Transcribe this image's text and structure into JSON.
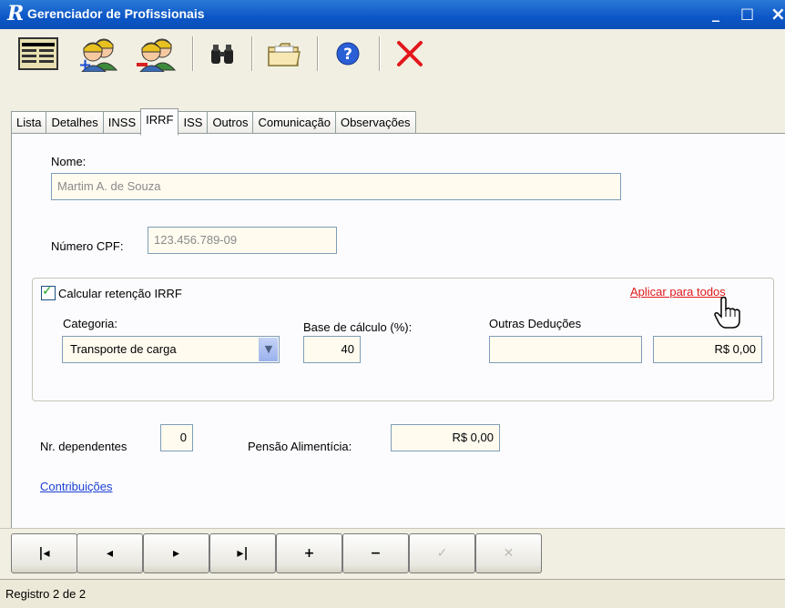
{
  "window": {
    "logo": "R",
    "title": "Gerenciador de Profissionais",
    "minimize": "_",
    "maximize": "□",
    "close": "×"
  },
  "tabs": [
    {
      "label": "Lista"
    },
    {
      "label": "Detalhes"
    },
    {
      "label": "INSS"
    },
    {
      "label": "IRRF"
    },
    {
      "label": "ISS"
    },
    {
      "label": "Outros"
    },
    {
      "label": "Comunicação"
    },
    {
      "label": "Observações"
    }
  ],
  "active_tab": "IRRF",
  "form": {
    "nome_label": "Nome:",
    "nome_value": "Martim A. de Souza",
    "cpf_label": "Número CPF:",
    "cpf_value": "123.456.789-09",
    "irrf_checkbox_label": "Calcular retenção IRRF",
    "irrf_checked": true,
    "aplicar_link": "Aplicar para todos",
    "categoria_label": "Categoria:",
    "categoria_value": "Transporte de carga",
    "base_label": "Base de cálculo (%):",
    "base_value": "40",
    "outras_label": "Outras Deduções",
    "outras_desc_value": "",
    "outras_value": "R$ 0,00",
    "dependentes_label": "Nr. dependentes",
    "dependentes_value": "0",
    "pensao_label": "Pensão Alimentícia:",
    "pensao_value": "R$ 0,00",
    "contribuicoes_link": "Contribuições"
  },
  "navigator": {
    "first": "|◂",
    "prior": "◂",
    "next": "▸",
    "last": "▸|",
    "insert": "+",
    "delete": "−",
    "post": "✓",
    "cancel": "✕"
  },
  "status": {
    "text": "Registro 2 de 2"
  },
  "colors": {
    "titlebar": "#0c56c7",
    "link_red": "#e0191b",
    "link_blue": "#1a3fd1",
    "field_bg": "#fffbef"
  }
}
